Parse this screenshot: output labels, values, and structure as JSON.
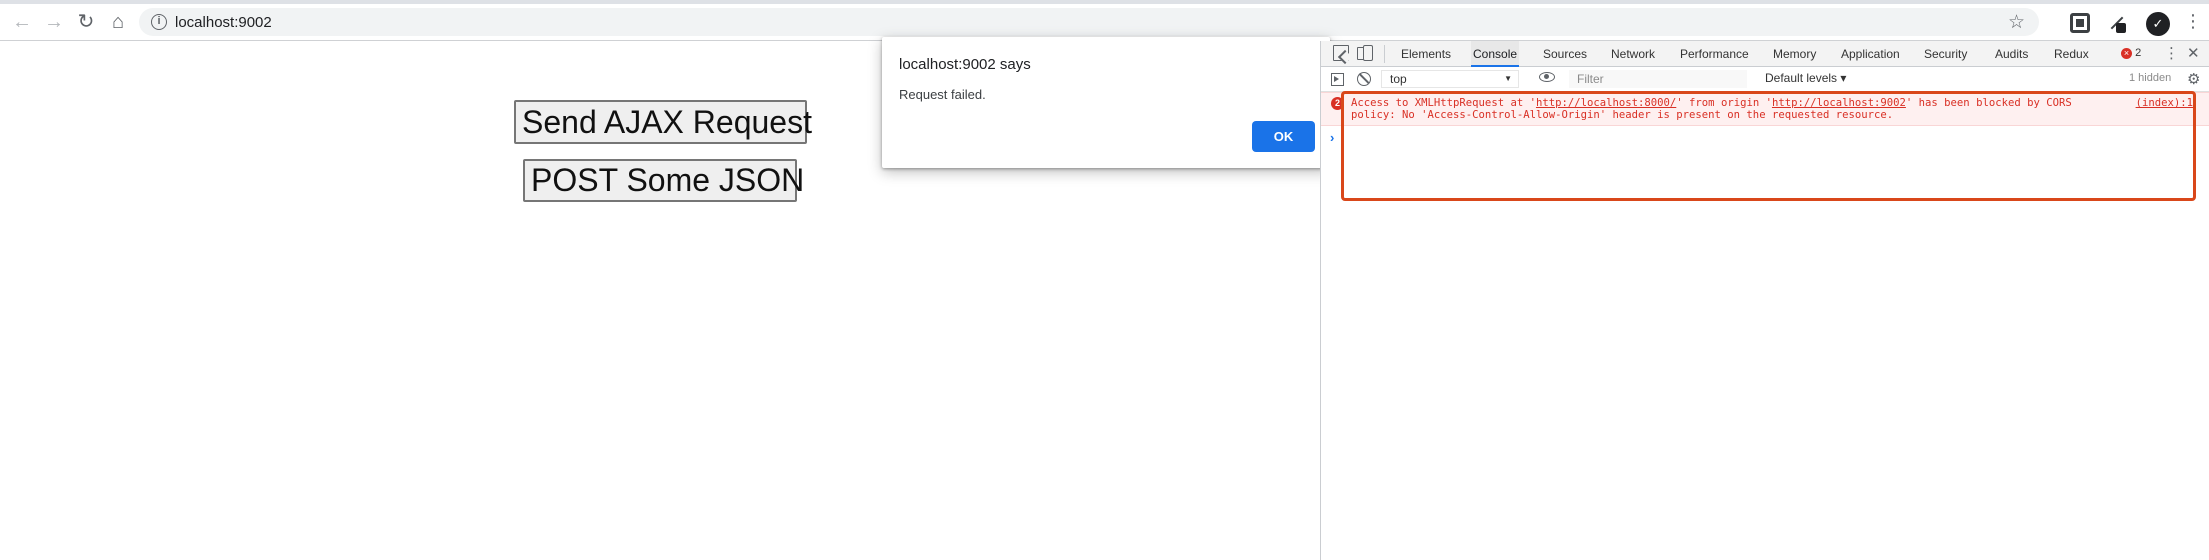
{
  "browser": {
    "url": "localhost:9002",
    "nav": {
      "back_icon": "arrow-left-icon",
      "forward_icon": "arrow-right-icon",
      "reload_icon": "reload-icon",
      "home_icon": "home-icon"
    },
    "profile_initial": "✓"
  },
  "page": {
    "buttons": [
      {
        "label": "Send AJAX Request"
      },
      {
        "label": "POST Some JSON"
      }
    ]
  },
  "alert": {
    "title": "localhost:9002 says",
    "message": "Request failed.",
    "ok_label": "OK"
  },
  "devtools": {
    "tabs": [
      {
        "label": "Elements",
        "active": false
      },
      {
        "label": "Console",
        "active": true
      },
      {
        "label": "Sources",
        "active": false
      },
      {
        "label": "Network",
        "active": false
      },
      {
        "label": "Performance",
        "active": false
      },
      {
        "label": "Memory",
        "active": false
      },
      {
        "label": "Application",
        "active": false
      },
      {
        "label": "Security",
        "active": false
      },
      {
        "label": "Audits",
        "active": false
      },
      {
        "label": "Redux",
        "active": false
      }
    ],
    "error_count": "2",
    "console_bar": {
      "context": "top",
      "filter_placeholder": "Filter",
      "levels": "Default levels ▾",
      "hidden": "1 hidden"
    },
    "message": {
      "count": "2",
      "part1": "Access to XMLHttpRequest at '",
      "url1": "http://localhost:8000/",
      "part2": "' from origin '",
      "url2": "http://localhost:9002",
      "part3": "' has been blocked by CORS",
      "line2": "policy: No 'Access-Control-Allow-Origin' header is present on the requested resource.",
      "source": "(index):1"
    }
  },
  "colors": {
    "accent": "#1a73e8",
    "error": "#d93025",
    "highlight": "#d9471a"
  }
}
